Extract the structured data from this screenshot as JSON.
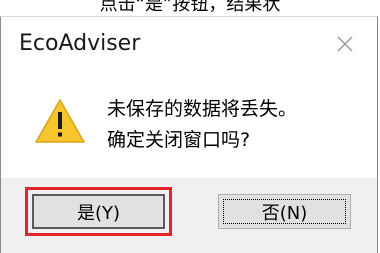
{
  "above_text": "点击“是”按钮，结果状",
  "dialog": {
    "title": "EcoAdviser",
    "close_glyph": "✕",
    "message_line1": "未保存的数据将丢失。",
    "message_line2": "确定关闭窗口吗?",
    "icon": "warning-icon",
    "buttons": {
      "yes_label": "是(Y)",
      "no_label": "否(N)"
    }
  },
  "colors": {
    "warning_fill": "#f7c52f",
    "highlight_border": "#e5232b",
    "footer_bg": "#f0f0f0"
  }
}
